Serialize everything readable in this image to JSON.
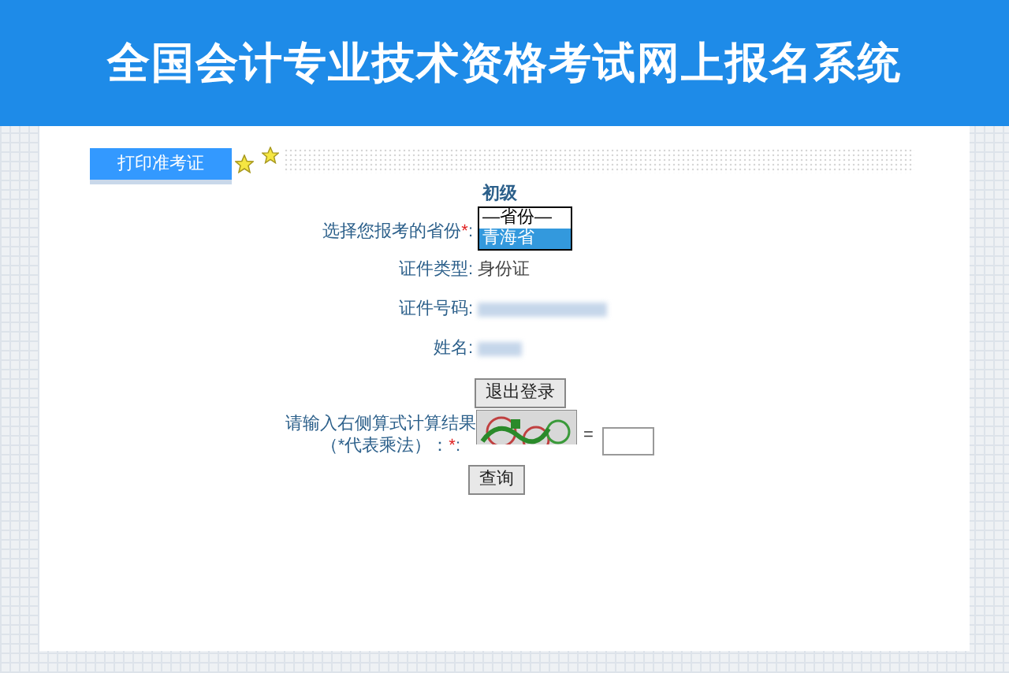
{
  "header": {
    "title": "全国会计专业技术资格考试网上报名系统"
  },
  "tabs": [
    {
      "label": "打印准考证",
      "selected": true
    }
  ],
  "form": {
    "level_text": "初级",
    "province": {
      "label": "选择您报考的省份",
      "mark": "*",
      "suffix": ":",
      "options": [
        {
          "label": "—省份—",
          "selected": false
        },
        {
          "label": "青海省",
          "selected": true
        }
      ]
    },
    "rows": [
      {
        "label": "证件类型:",
        "value": "身份证",
        "redacted": false
      },
      {
        "label": "证件号码:",
        "redacted": true
      },
      {
        "label": "姓名:",
        "redacted": true
      }
    ],
    "logout_button": "退出登录",
    "captcha": {
      "label_line1": "请输入右侧算式计算结果",
      "label_line2": "（*代表乘法）：",
      "mark": "*",
      "suffix": ":",
      "equals": "="
    },
    "query_button": "查询"
  }
}
